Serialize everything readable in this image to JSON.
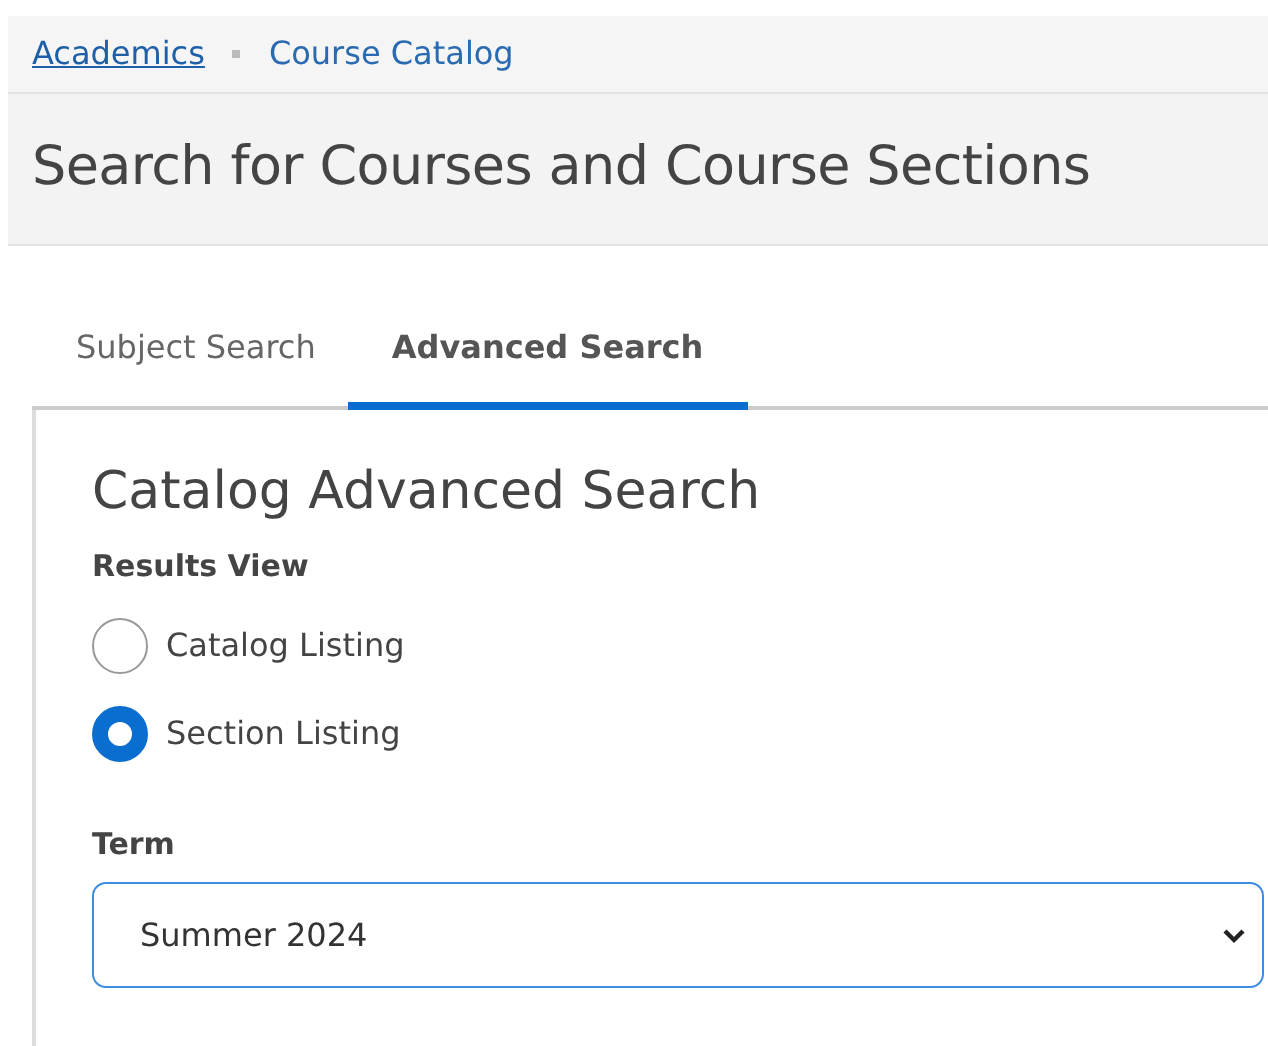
{
  "breadcrumbs": [
    {
      "label": "Academics",
      "current": false
    },
    {
      "label": "Course Catalog",
      "current": true
    }
  ],
  "page_title": "Search for Courses and Course Sections",
  "tabs": [
    {
      "label": "Subject Search",
      "selected": false
    },
    {
      "label": "Advanced Search",
      "selected": true
    }
  ],
  "panel": {
    "title": "Catalog Advanced Search",
    "results_view": {
      "label": "Results View",
      "options": [
        {
          "label": "Catalog Listing",
          "selected": false
        },
        {
          "label": "Section Listing",
          "selected": true
        }
      ]
    },
    "term": {
      "label": "Term",
      "value": "Summer 2024"
    }
  }
}
